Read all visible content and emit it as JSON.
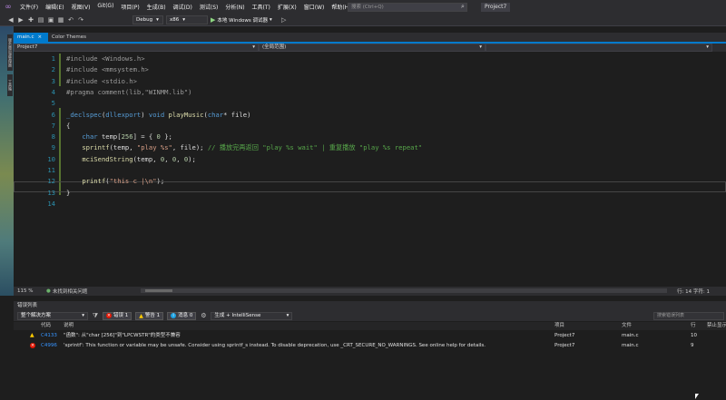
{
  "menu": {
    "items": [
      "文件(F)",
      "编辑(E)",
      "视图(V)",
      "Git(G)",
      "项目(P)",
      "生成(B)",
      "调试(D)",
      "测试(S)",
      "分析(N)",
      "工具(T)",
      "扩展(X)",
      "窗口(W)",
      "帮助(H)"
    ],
    "search_placeholder": "搜索 (Ctrl+Q)",
    "project_title": "Project7"
  },
  "toolbar": {
    "config": "Debug",
    "platform": "x86",
    "run_label": "本地 Windows 调试器"
  },
  "side_tabs": [
    "服务器资源管理器",
    "工具箱"
  ],
  "tabs": {
    "file_tab": "main.c",
    "themes_tab": "Color Themes"
  },
  "nav": {
    "project": "Project7",
    "scope": "(全局范围)"
  },
  "code_lines": [
    {
      "n": "1",
      "html": "<span class=\"pp\">#include &lt;Windows.h&gt;</span>"
    },
    {
      "n": "2",
      "html": "<span class=\"pp\">#include &lt;mmsystem.h&gt;</span>"
    },
    {
      "n": "3",
      "html": "<span class=\"pp\">#include &lt;stdio.h&gt;</span>"
    },
    {
      "n": "4",
      "html": "<span class=\"pp\">#pragma comment(lib,\"WINMM.lib\")</span>"
    },
    {
      "n": "5",
      "html": ""
    },
    {
      "n": "6",
      "html": "<span class=\"kw\">_declspec</span>(<span class=\"kw\">dllexport</span>) <span class=\"kw\">void</span> <span class=\"fn\">playMusic</span>(<span class=\"kw\">char</span>* file)"
    },
    {
      "n": "7",
      "html": "{"
    },
    {
      "n": "8",
      "html": "    <span class=\"kw\">char</span> temp[<span class=\"num\">256</span>] = { <span class=\"num\">0</span> };"
    },
    {
      "n": "9",
      "html": "    <span class=\"fn\">sprintf</span>(temp, <span class=\"str\">\"play %s\"</span>, file); <span class=\"cm\">// 播放完再返回 \"play %s wait\" | 重复播放 \"play %s repeat\"</span>"
    },
    {
      "n": "10",
      "html": "    <span class=\"fn\">mciSendString</span>(temp, <span class=\"num\">0</span>, <span class=\"num\">0</span>, <span class=\"num\">0</span>);"
    },
    {
      "n": "11",
      "html": ""
    },
    {
      "n": "12",
      "html": "    <span class=\"fn\">printf</span>(<span class=\"str\">\"this c |\\n\"</span>);"
    },
    {
      "n": "13",
      "html": "}"
    },
    {
      "n": "14",
      "html": ""
    }
  ],
  "editor_status": {
    "zoom": "115 %",
    "issues": "未找到相关问题",
    "position": "行: 14   字符: 1"
  },
  "error_list": {
    "title": "错误列表",
    "scope": "整个解决方案",
    "errors": "错误 1",
    "warnings": "警告 1",
    "messages": "消息 0",
    "build_filter": "生成 + IntelliSense",
    "search_placeholder": "搜索错误列表",
    "headers": {
      "code": "代码",
      "desc": "说明",
      "project": "项目",
      "file": "文件",
      "line": "行",
      "suppress": "禁止显示"
    },
    "rows": [
      {
        "severity": "warning",
        "code": "C4133",
        "desc": "\"函数\": 从\"char [256]\"到\"LPCWSTR\"的类型不兼容",
        "project": "Project7",
        "file": "main.c",
        "line": "10"
      },
      {
        "severity": "error",
        "code": "C4996",
        "desc": "'sprintf': This function or variable may be unsafe. Consider using sprintf_s instead. To disable deprecation, use _CRT_SECURE_NO_WARNINGS. See online help for details.",
        "project": "Project7",
        "file": "main.c",
        "line": "9"
      }
    ]
  }
}
